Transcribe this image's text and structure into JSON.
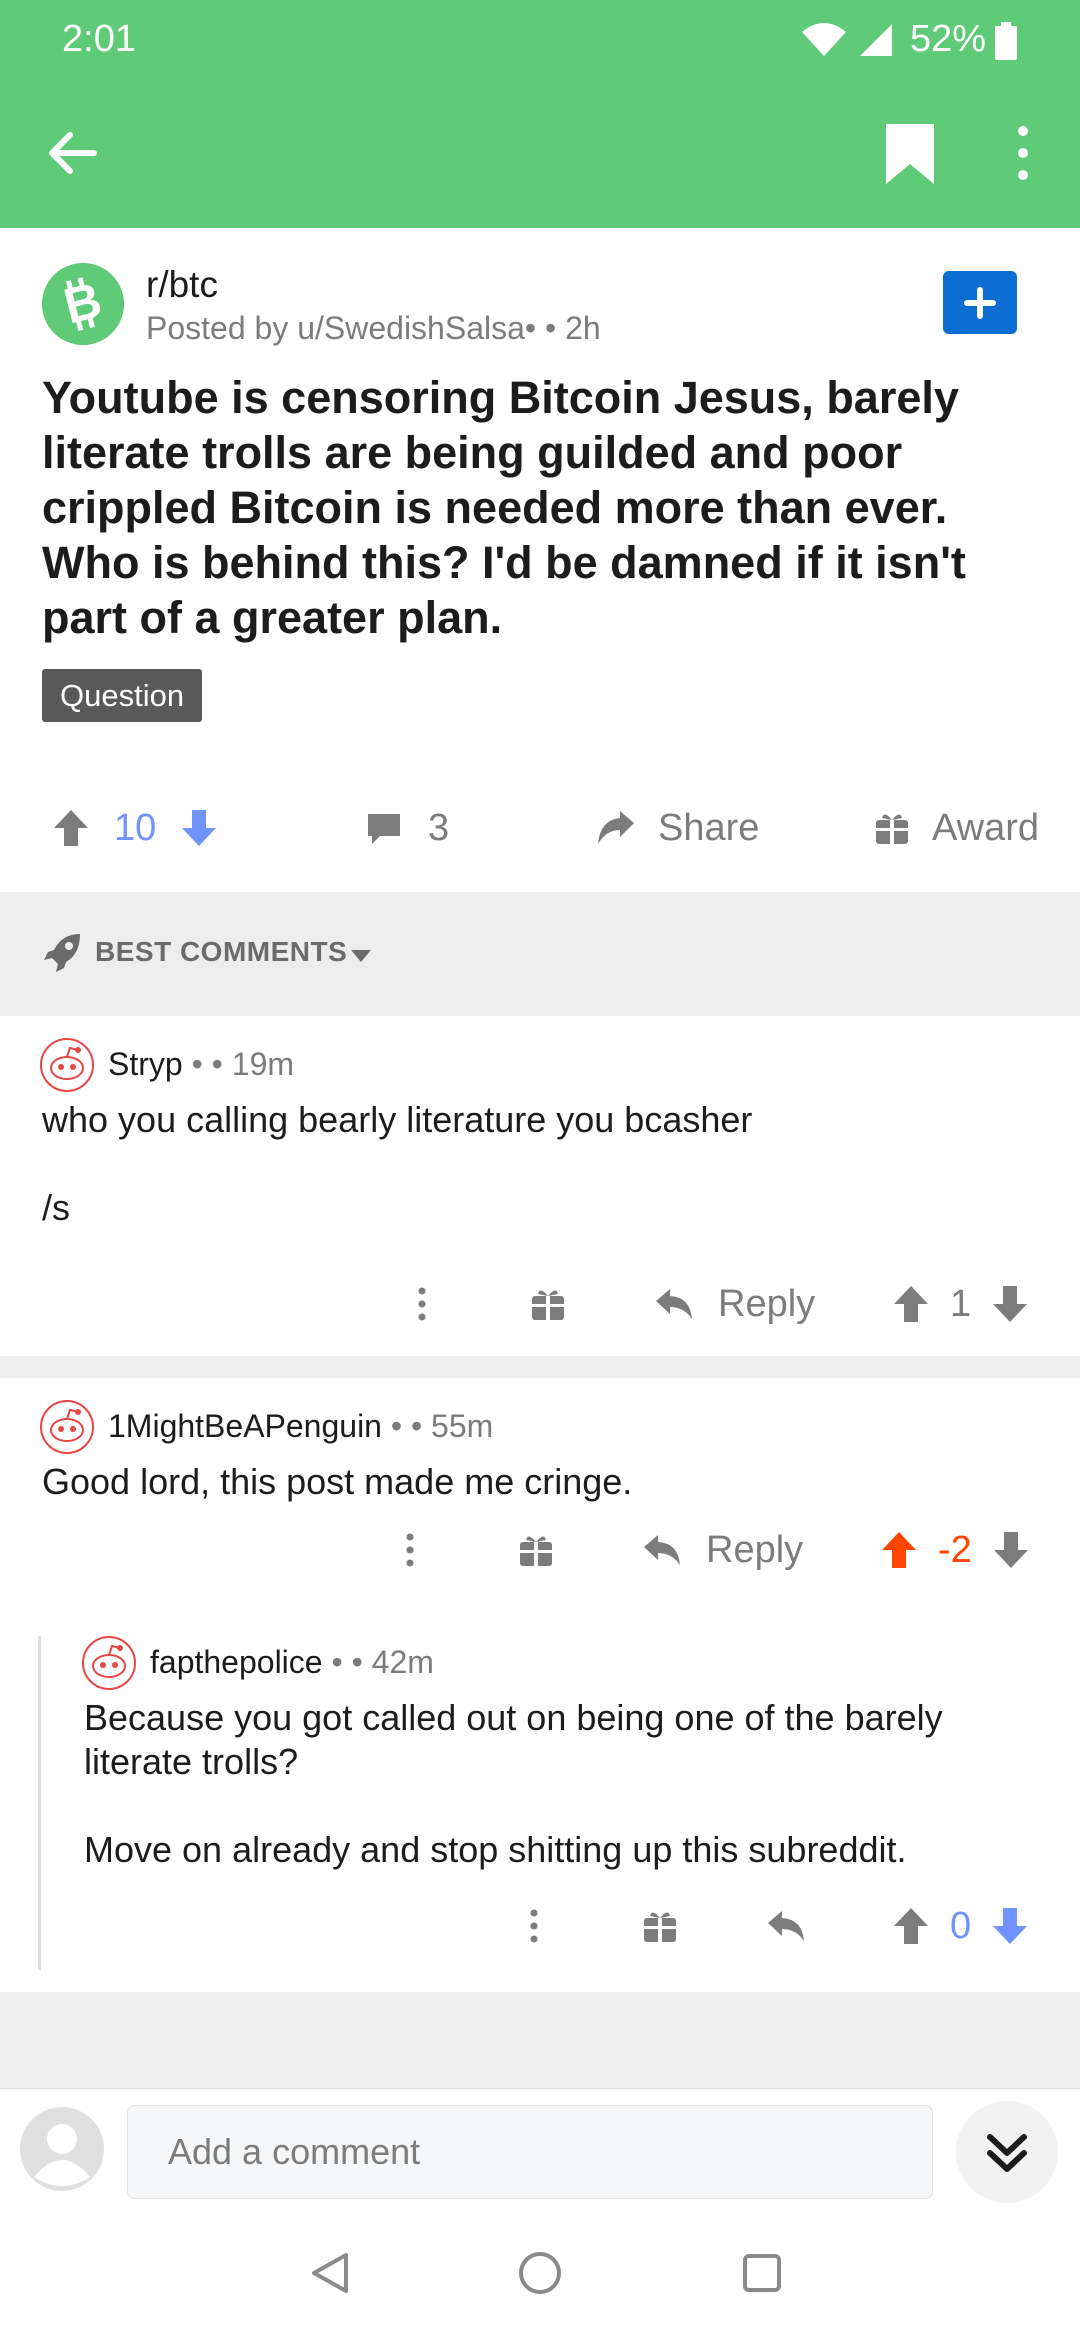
{
  "status_bar": {
    "time": "2:01",
    "battery": "52%"
  },
  "post": {
    "subreddit": "r/btc",
    "posted_by": "Posted by u/SwedishSalsa• • 2h",
    "title": "Youtube is censoring Bitcoin Jesus, barely literate trolls are being guilded and poor crippled Bitcoin is needed more than ever. Who is behind this? I'd be damned if it isn't part of a greater plan.",
    "flair": "Question",
    "score": "10",
    "comments": "3",
    "share_label": "Share",
    "award_label": "Award"
  },
  "sort": {
    "label": "BEST COMMENTS"
  },
  "comments": [
    {
      "author": "Stryp",
      "meta": " • • 19m",
      "body": "who you calling bearly literature you bcasher\n\n/s",
      "reply_label": "Reply",
      "score": "1"
    },
    {
      "author": "1MightBeAPenguin",
      "meta": " • • 55m",
      "body": "Good lord, this post made me cringe.",
      "reply_label": "Reply",
      "score": "-2"
    },
    {
      "author": "fapthepolice",
      "meta": " • • 42m",
      "body": "Because you got called out on being one of the barely literate trolls?\n\nMove on already and stop shitting up this subreddit.",
      "score": "0"
    }
  ],
  "composer": {
    "placeholder": "Add a comment"
  },
  "colors": {
    "header": "#5fca78",
    "upvote": "#ff4500",
    "downvote": "#7193ff",
    "join": "#0c6ed2"
  }
}
